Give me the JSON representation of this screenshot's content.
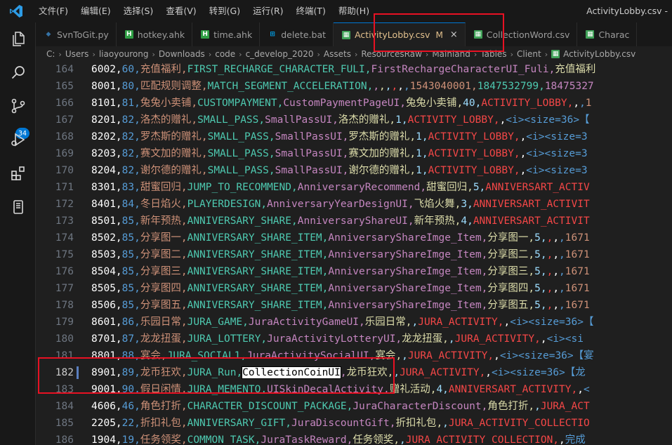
{
  "menu": [
    "文件(F)",
    "编辑(E)",
    "选择(S)",
    "查看(V)",
    "转到(G)",
    "运行(R)",
    "终端(T)",
    "帮助(H)"
  ],
  "window_title": "ActivityLobby.csv -",
  "tabs": [
    {
      "label": "SvnToGit.py",
      "icon": "python-file-icon"
    },
    {
      "label": "hotkey.ahk",
      "icon": "ahk-file-icon"
    },
    {
      "label": "time.ahk",
      "icon": "ahk-file-icon"
    },
    {
      "label": "delete.bat",
      "icon": "windows-bat-file-icon"
    },
    {
      "label": "ActivityLobby.csv",
      "icon": "csv-file-icon",
      "active": true,
      "modified": "M",
      "close": "×"
    },
    {
      "label": "CollectionWord.csv",
      "icon": "csv-file-icon"
    },
    {
      "label": "Charac",
      "icon": "csv-file-icon"
    }
  ],
  "breadcrumb": [
    "C:",
    "Users",
    "liaoyourong",
    "Downloads",
    "code",
    "c_develop_2020",
    "Assets",
    "ResourcesRaw",
    "Mainland",
    "Tables",
    "Client",
    "ActivityLobby.csv"
  ],
  "scm_badge": "34",
  "colors": {
    "accent": "#0078d4",
    "annotation": "#e81123"
  },
  "lines": [
    {
      "n": "164",
      "text": "6002,60,充值福利,FIRST_RECHARGE_CHARACTER_FULI,FirstRechargeCharacterUI_Fuli,充值福利"
    },
    {
      "n": "165",
      "text": "8001,80,匹配规则调整,MATCH_SEGMENT_ACCELERATION,,,,,,,1543040001,1847532799,18475327"
    },
    {
      "n": "166",
      "text": "8101,81,兔兔小卖铺,CUSTOMPAYMENT,CustomPaymentPageUI,兔兔小卖铺,40,ACTIVITY_LOBBY,,,1"
    },
    {
      "n": "167",
      "text": "8201,82,洛杰的赠礼,SMALL_PASS,SmallPassUI,洛杰的赠礼,1,ACTIVITY_LOBBY,,<i><size=36>【"
    },
    {
      "n": "168",
      "text": "8202,82,罗杰斯的赠礼,SMALL_PASS,SmallPassUI,罗杰斯的赠礼,1,ACTIVITY_LOBBY,,<i><size=3"
    },
    {
      "n": "169",
      "text": "8203,82,赛文加的赠礼,SMALL_PASS,SmallPassUI,赛文加的赠礼,1,ACTIVITY_LOBBY,,<i><size=3"
    },
    {
      "n": "170",
      "text": "8204,82,谢尔德的赠礼,SMALL_PASS,SmallPassUI,谢尔德的赠礼,1,ACTIVITY_LOBBY,,<i><size=3"
    },
    {
      "n": "171",
      "text": "8301,83,甜蜜回归,JUMP_TO_RECOMMEND,AnniversaryRecommend,甜蜜回归,5,ANNIVERSART_ACTIV"
    },
    {
      "n": "172",
      "text": "8401,84,冬日焰火,PLAYERDESIGN,AnniversaryYearDesignUI,飞焰火舞,3,ANNIVERSART_ACTIVIT"
    },
    {
      "n": "173",
      "text": "8501,85,新年预热,ANNIVERSARY_SHARE,AnniversaryShareUI,新年预热,4,ANNIVERSART_ACTIVIT"
    },
    {
      "n": "174",
      "text": "8502,85,分享图一,ANNIVERSARY_SHARE_ITEM,AnniversaryShareImge_Item,分享图一,5,,,,1671"
    },
    {
      "n": "175",
      "text": "8503,85,分享图二,ANNIVERSARY_SHARE_ITEM,AnniversaryShareImge_Item,分享图二,5,,,,1671"
    },
    {
      "n": "176",
      "text": "8504,85,分享图三,ANNIVERSARY_SHARE_ITEM,AnniversaryShareImge_Item,分享图三,5,,,,1671"
    },
    {
      "n": "177",
      "text": "8505,85,分享图四,ANNIVERSARY_SHARE_ITEM,AnniversaryShareImge_Item,分享图四,5,,,,1671"
    },
    {
      "n": "178",
      "text": "8506,85,分享图五,ANNIVERSARY_SHARE_ITEM,AnniversaryShareImge_Item,分享图五,5,,,,1671"
    },
    {
      "n": "179",
      "text": "8601,86,乐园日常,JURA_GAME,JuraActivityGameUI,乐园日常,,JURA_ACTIVITY,,<i><size=36>【"
    },
    {
      "n": "180",
      "text": "8701,87,龙龙扭蛋,JURA_LOTTERY,JuraActivityLotteryUI,龙龙扭蛋,,JURA_ACTIVITY,,<i><si"
    },
    {
      "n": "181",
      "text": "8801,88,宴会,JURA_SOCIAL1,JuraActivitySocialUI,宴会,,JURA_ACTIVITY,,<i><size=36>【宴"
    },
    {
      "n": "182",
      "text": "8901,89,龙币狂欢,JURA_Run,CollectionCoinUI,龙币狂欢,,JURA_ACTIVITY,,<i><size=36>【龙",
      "current": true
    },
    {
      "n": "183",
      "text": "9001,90,假日闲情,JURA_MEMENTO,UISkinDecalActivity,赠礼活动,4,ANNIVERSART_ACTIVITY,,<"
    },
    {
      "n": "184",
      "text": "4606,46,角色打折,CHARACTER_DISCOUNT_PACKAGE,JuraCharacterDiscount,角色打折,,JURA_ACT"
    },
    {
      "n": "185",
      "text": "2205,22,折扣礼包,ANNIVERSARY_GIFT,JuraDiscountGift,折扣礼包,,JURA_ACTIVITY_COLLECTIO"
    },
    {
      "n": "186",
      "text": "1904,19,任务领奖,COMMON_TASK,JuraTaskReward,任务领奖,,JURA_ACTIVITY_COLLECTION,,完成"
    }
  ]
}
